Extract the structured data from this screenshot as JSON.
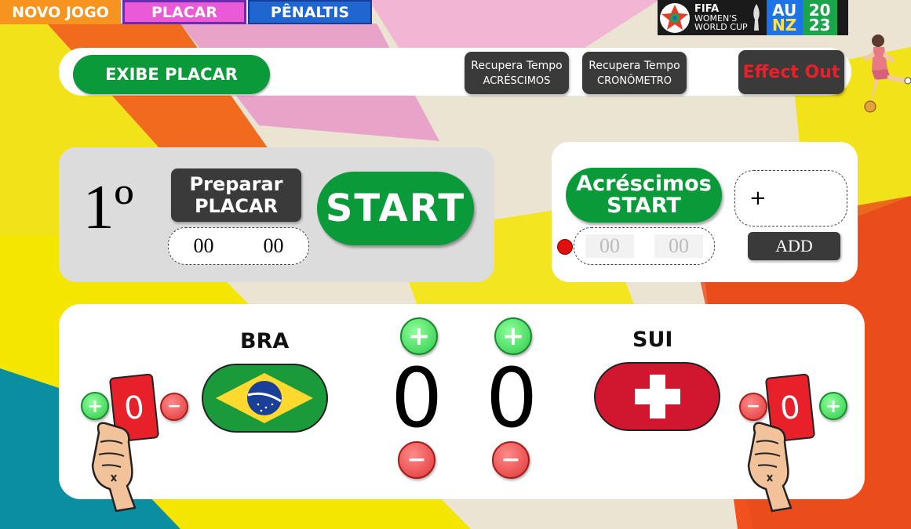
{
  "tabs": [
    {
      "label": "NOVO JOGO",
      "color": "#f5941e"
    },
    {
      "label": "PLACAR",
      "color": "#ea5ad6"
    },
    {
      "label": "PÊNALTIS",
      "color": "#1f66d1"
    }
  ],
  "logo": {
    "fifa": "FIFA",
    "line1": "WOMEN'S",
    "line2": "WORLD CUP",
    "au": "AU",
    "nz": "NZ",
    "year_top": "20",
    "year_bottom": "23"
  },
  "toolbar": {
    "exibe_placar": "EXIBE PLACAR",
    "recupera_acrescimos_top": "Recupera Tempo",
    "recupera_acrescimos_bottom": "ACRÉSCIMOS",
    "recupera_cronometro_top": "Recupera Tempo",
    "recupera_cronometro_bottom": "CRONÔMETRO",
    "effect_out": "Effect Out"
  },
  "timer": {
    "period": "1º",
    "preparar_top": "Preparar",
    "preparar_bottom": "PLACAR",
    "minutes": "00",
    "seconds": "00",
    "start": "START"
  },
  "extra_time": {
    "start_top": "Acréscimos",
    "start_bottom": "START",
    "input_value": "+",
    "add": "ADD",
    "minutes_placeholder": "00",
    "seconds_placeholder": "00"
  },
  "scoreboard": {
    "home": {
      "name": "BRA",
      "score": "0",
      "red_cards": "0"
    },
    "away": {
      "name": "SUI",
      "score": "0",
      "red_cards": "0"
    },
    "plus_symbol": "+",
    "minus_symbol": "−"
  },
  "colors": {
    "green": "#0a9a3a",
    "dark": "#3a3a3a",
    "effect_red": "#e8202a",
    "card_red": "#e8202a"
  }
}
